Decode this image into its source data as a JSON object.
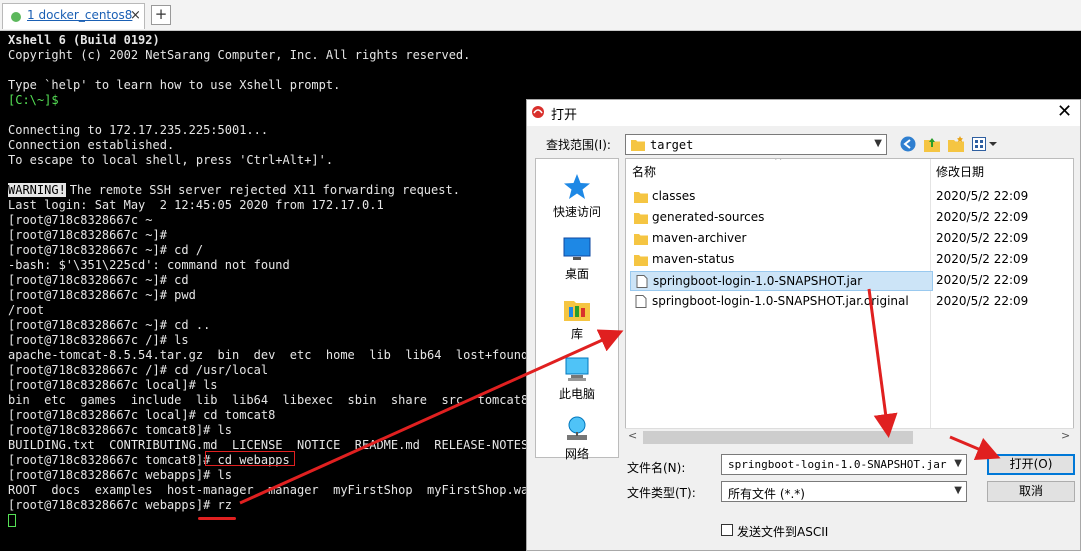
{
  "tab": {
    "title": "1 docker_centos8",
    "close": "×",
    "add": "+"
  },
  "terminal": {
    "lines": [
      "Xshell 6 (Build 0192)",
      "Copyright (c) 2002 NetSarang Computer, Inc. All rights reserved.",
      "",
      "Type `help' to learn how to use Xshell prompt.",
      "[C:\\~]$",
      "",
      "Connecting to 172.17.235.225:5001...",
      "Connection established.",
      "To escape to local shell, press 'Ctrl+Alt+]'.",
      "",
      "The remote SSH server rejected X11 forwarding request.",
      "Last login: Sat May  2 12:45:05 2020 from 172.17.0.1",
      "[root@718c8328667c ~",
      "[root@718c8328667c ~]#",
      "[root@718c8328667c ~]# cd /",
      "-bash: $'\\351\\225cd': command not found",
      "[root@718c8328667c ~]# cd",
      "[root@718c8328667c ~]# pwd",
      "/root",
      "[root@718c8328667c ~]# cd ..",
      "[root@718c8328667c /]# ls",
      "apache-tomcat-8.5.54.tar.gz  bin  dev  etc  home  lib  lib64  lost+found",
      "[root@718c8328667c /]# cd /usr/local",
      "[root@718c8328667c local]# ls",
      "bin  etc  games  include  lib  lib64  libexec  sbin  share  src  tomcat8",
      "[root@718c8328667c local]# cd tomcat8",
      "[root@718c8328667c tomcat8]# ls",
      "BUILDING.txt  CONTRIBUTING.md  LICENSE  NOTICE  README.md  RELEASE-NOTES",
      "[root@718c8328667c tomcat8]# cd webapps",
      "[root@718c8328667c webapps]# ls",
      "ROOT  docs  examples  host-manager  manager  myFirstShop  myFirstShop.war",
      "[root@718c8328667c webapps]# rz"
    ],
    "warning_badge": "WARNING!"
  },
  "dialog": {
    "title": "打开",
    "lookin_label": "查找范围(I):",
    "lookin_value": "target",
    "places": [
      "快速访问",
      "桌面",
      "库",
      "此电脑",
      "网络"
    ],
    "col_name": "名称",
    "col_date": "修改日期",
    "files": [
      {
        "name": "classes",
        "date": "2020/5/2 22:09",
        "type": "folder"
      },
      {
        "name": "generated-sources",
        "date": "2020/5/2 22:09",
        "type": "folder"
      },
      {
        "name": "maven-archiver",
        "date": "2020/5/2 22:09",
        "type": "folder"
      },
      {
        "name": "maven-status",
        "date": "2020/5/2 22:09",
        "type": "folder"
      },
      {
        "name": "springboot-login-1.0-SNAPSHOT.jar",
        "date": "2020/5/2 22:09",
        "type": "file",
        "selected": true
      },
      {
        "name": "springboot-login-1.0-SNAPSHOT.jar.original",
        "date": "2020/5/2 22:09",
        "type": "file"
      }
    ],
    "filename_label": "文件名(N):",
    "filename_value": "springboot-login-1.0-SNAPSHOT.jar",
    "filetype_label": "文件类型(T):",
    "filetype_value": "所有文件 (*.*)",
    "open_button": "打开(O)",
    "cancel_button": "取消",
    "ascii_checkbox": "发送文件到ASCII"
  },
  "colors": {
    "annotation": "#e02020",
    "prompt_green": "#55e055",
    "selection": "#cce4f7",
    "accent": "#0078d7"
  }
}
